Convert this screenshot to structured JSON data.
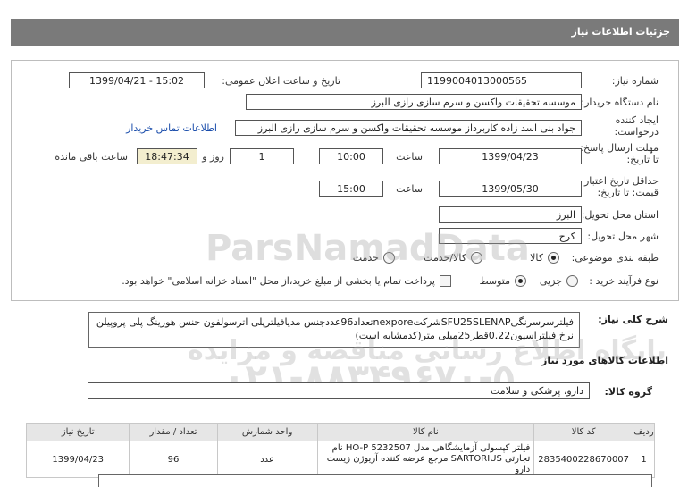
{
  "header": {
    "title": "جزئیات اطلاعات نیاز"
  },
  "form": {
    "need_number_label": "شماره نیاز:",
    "need_number": "1199004013000565",
    "announce_label": "تاریخ و ساعت اعلان عمومی:",
    "announce_value": "1399/04/21 - 15:02",
    "buyer_org_label": "نام دستگاه خریدار:",
    "buyer_org": "موسسه تحقیقات واکسن و سرم سازی رازی البرز",
    "requester_label_1": "ایجاد کننده",
    "requester_label_2": "درخواست:",
    "requester": "جواد بنی اسد زاده کاربرداز موسسه تحقیقات واکسن و سرم سازی رازی البرز",
    "contact_link": "اطلاعات تماس خریدار",
    "send_deadline_label_1": "مهلت ارسال پاسخ:",
    "send_deadline_label_2": "تا تاریخ:",
    "send_date": "1399/04/23",
    "time_label": "ساعت",
    "send_time": "10:00",
    "days_value": "1",
    "days_label": "روز و",
    "remaining_time": "18:47:34",
    "remaining_label": "ساعت باقی مانده",
    "validity_label_1": "حداقل تاریخ اعتبار",
    "validity_label_2": "قیمت: تا تاریخ:",
    "validity_date": "1399/05/30",
    "validity_time_label": "ساعت",
    "validity_time": "15:00",
    "province_label": "استان محل تحویل:",
    "province": "البرز",
    "city_label": "شهر محل تحویل:",
    "city": "کرج",
    "category_label": "طبقه بندی موضوعی:",
    "category_options": [
      "کالا",
      "کالا/خدمت",
      "خدمت"
    ],
    "category_selected": "کالا",
    "purchase_label": "نوع فرآیند خرید :",
    "purchase_options": [
      "جزیی",
      "متوسط"
    ],
    "purchase_selected": "متوسط",
    "treasury_note": "پرداخت تمام یا بخشی از مبلغ خرید،از محل \"اسناد خزانه اسلامی\" خواهد بود."
  },
  "description": {
    "label": "شرح کلی نیاز:",
    "text": "فیلترسرسرنگیSFU25SLENAPشرکتnexporeتعداد96عددجنس مدیافیلترپلی اترسولفون جنس هوزینگ پلی پروپیلن نرخ فیلتراسیون0.22قطر25میلی متر(کدمشابه است)"
  },
  "goods_section": {
    "title": "اطلاعات کالاهای مورد نیاز",
    "group_label": "گروه کالا:",
    "group_value": "دارو، پزشکی و سلامت"
  },
  "table": {
    "headers": [
      "ردیف",
      "کد کالا",
      "نام کالا",
      "واحد شمارش",
      "تعداد / مقدار",
      "تاریخ نیاز"
    ],
    "rows": [
      {
        "row": "1",
        "code": "2835400228670007",
        "name": "فیلتر کپسولی آزمایشگاهی مدل HO-P 5232507 نام تجارتی SARTORIUS مرجع عرضه کننده آریوژن زیست دارو",
        "unit": "عدد",
        "qty": "96",
        "date": "1399/04/23"
      }
    ]
  },
  "watermark": {
    "brand": "ParsNamadData",
    "line": "پایگاه اطلاع رسانی مناقصه و مزایده",
    "phone": "۰۲۱-۸۸۳۴۹۶۷۰-۵"
  },
  "colors": {
    "header_bg": "#7a7a7a",
    "link": "#1a4dab",
    "timer_bg": "#f3eecf"
  }
}
